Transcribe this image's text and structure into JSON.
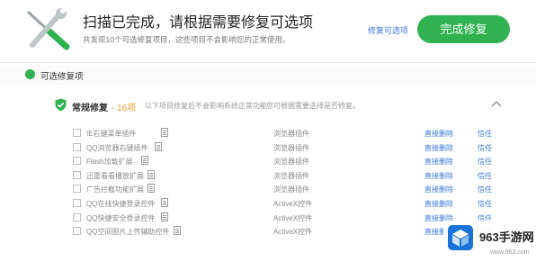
{
  "header": {
    "title": "扫描已完成，请根据需要修复可选项",
    "subtitle": "共发现10个可选修复项目，这些项目不会影响您的正常使用。",
    "select_link": "修复可选项",
    "primary_button": "完成修复",
    "icon": "wrench-screwdriver-icon"
  },
  "section": {
    "label": "可选修复项",
    "bullet_color": "#2fb24f"
  },
  "group": {
    "title": "常规修复",
    "count": "- 16项",
    "note_left": "以下项目修复后不会影响系统正常功能",
    "note_right": "您可根据需要选择是否修复。",
    "icon": "shield-check-icon",
    "collapse_icon": "chevron-up-icon"
  },
  "rows": [
    {
      "name": "IE右键菜单插件",
      "type": "浏览器插件",
      "status": "直接删除",
      "trust": "信任"
    },
    {
      "name": "QQ浏览器右键插件",
      "type": "浏览器插件",
      "status": "直接删除",
      "trust": "信任"
    },
    {
      "name": "Flash加载扩展",
      "type": "浏览器插件",
      "status": "直接删除",
      "trust": "信任"
    },
    {
      "name": "迅雷看看播放扩展",
      "type": "浏览器插件",
      "status": "直接删除",
      "trust": "信任"
    },
    {
      "name": "广告拦截功能扩展",
      "type": "浏览器插件",
      "status": "直接删除",
      "trust": "信任"
    },
    {
      "name": "QQ在线快捷登录控件",
      "type": "ActiveX控件",
      "status": "直接删除",
      "trust": "信任"
    },
    {
      "name": "QQ快捷安全登录控件",
      "type": "ActiveX控件",
      "status": "直接删除",
      "trust": "信任"
    },
    {
      "name": "QQ空间图片上传辅助控件",
      "type": "ActiveX控件",
      "status": "直接删除",
      "trust": "信任"
    }
  ],
  "watermark": {
    "brand": "963手游网",
    "domain": "www.963.com"
  },
  "colors": {
    "accent": "#2fb24f",
    "link": "#3a7ad9",
    "count": "#f29a38"
  }
}
